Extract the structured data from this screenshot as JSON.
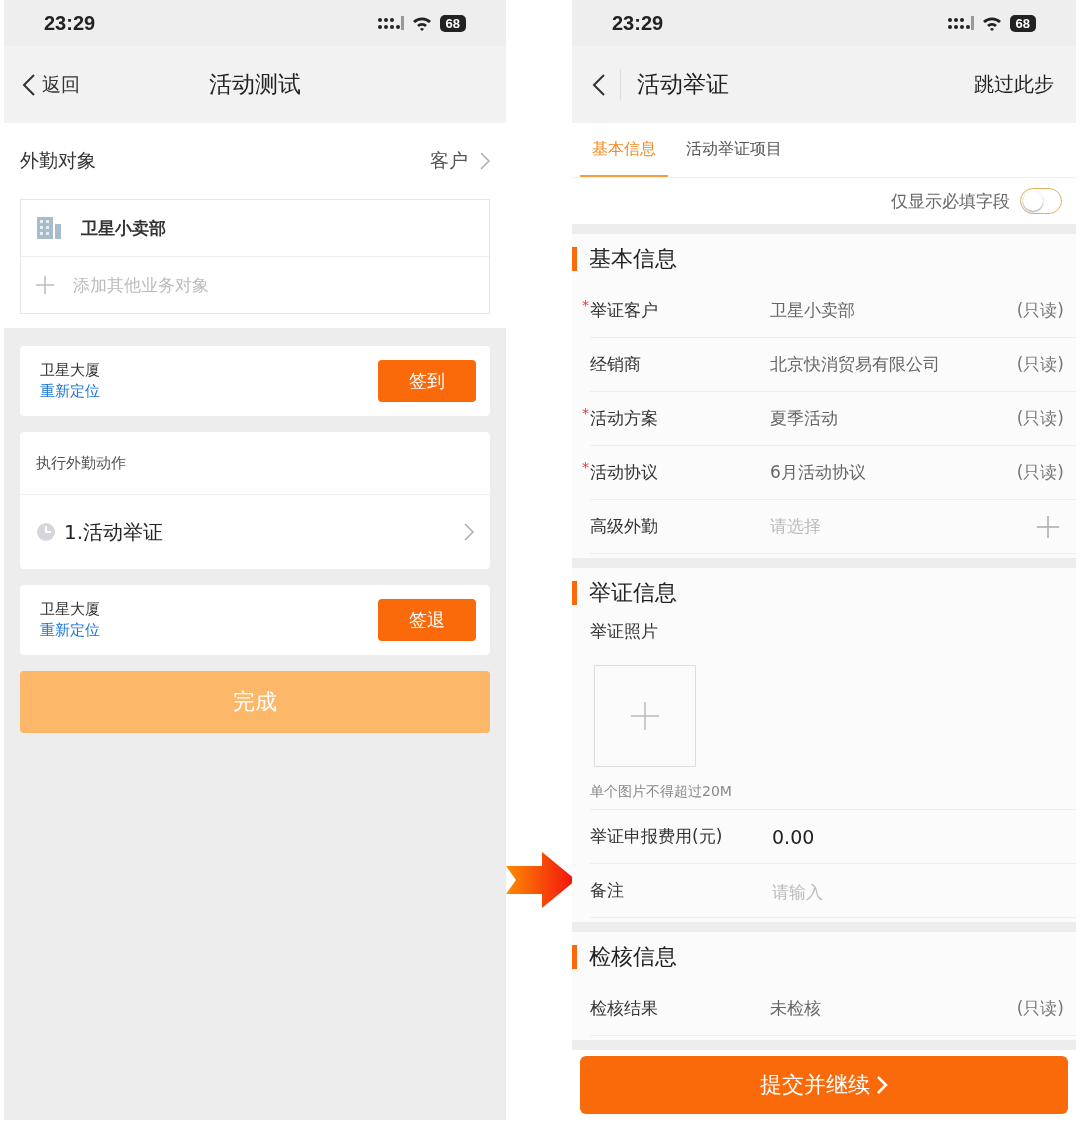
{
  "left_phone": {
    "status_bar": {
      "time": "23:29",
      "battery": "68"
    },
    "nav": {
      "back": "返回",
      "title": "活动测试"
    },
    "target": {
      "label": "外勤对象",
      "value": "客户",
      "store": "卫星小卖部",
      "add_placeholder": "添加其他业务对象"
    },
    "checkin": {
      "place": "卫星大厦",
      "relocate": "重新定位",
      "button": "签到"
    },
    "actions": {
      "title": "执行外勤动作",
      "items": [
        {
          "label": "1.活动举证"
        }
      ]
    },
    "checkout": {
      "place": "卫星大厦",
      "relocate": "重新定位",
      "button": "签退"
    },
    "done": {
      "label": "完成",
      "disabled": true
    }
  },
  "right_phone": {
    "status_bar": {
      "time": "23:29",
      "battery": "68"
    },
    "nav": {
      "title": "活动举证",
      "skip": "跳过此步"
    },
    "tabs": [
      {
        "label": "基本信息",
        "selected": true
      },
      {
        "label": "活动举证项目",
        "selected": false
      }
    ],
    "required_only": {
      "label": "仅显示必填字段",
      "on": false
    },
    "sections": [
      {
        "title": "基本信息",
        "rows": [
          {
            "kind": "readonly",
            "required_mark": "*",
            "label": "举证客户",
            "value": "卫星小卖部",
            "note": "(只读)"
          },
          {
            "kind": "readonly",
            "label": "经销商",
            "value": "北京快消贸易有限公司",
            "note": "(只读)"
          },
          {
            "kind": "readonly",
            "required_mark": "*",
            "label": "活动方案",
            "value": "夏季活动",
            "note": "(只读)"
          },
          {
            "kind": "readonly",
            "required_mark": "*",
            "label": "活动协议",
            "value": "6月活动协议",
            "note": "(只读)"
          },
          {
            "kind": "select",
            "label": "高级外勤",
            "placeholder": "请选择"
          }
        ]
      },
      {
        "title": "举证信息",
        "rows": [
          {
            "kind": "photo",
            "label": "举证照片",
            "hint": "单个图片不得超过20M"
          },
          {
            "kind": "input",
            "label": "举证申报费用(元)",
            "value": "0.00"
          },
          {
            "kind": "input",
            "label": "备注",
            "placeholder": "请输入"
          }
        ]
      },
      {
        "title": "检核信息",
        "rows": [
          {
            "kind": "readonly",
            "label": "检核结果",
            "value": "未检核",
            "note": "(只读)"
          }
        ]
      }
    ],
    "submit": {
      "label": "提交并继续"
    }
  }
}
